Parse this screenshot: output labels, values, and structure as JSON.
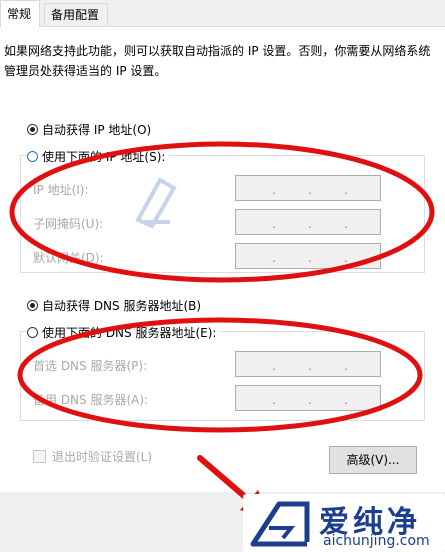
{
  "tabs": [
    {
      "label": "常规",
      "active": true
    },
    {
      "label": "备用配置",
      "active": false
    }
  ],
  "description": "如果网络支持此功能，则可以获取自动指派的 IP 设置。否则，你需要从网络系统管理员处获得适当的 IP 设置。",
  "ip_section": {
    "auto_label": "自动获得 IP 地址(O)",
    "auto_selected": true,
    "manual_label": "使用下面的 IP 地址(S):",
    "fields": [
      {
        "label": "IP 地址(I):"
      },
      {
        "label": "子网掩码(U):"
      },
      {
        "label": "默认网关(D):"
      }
    ]
  },
  "dns_section": {
    "auto_label": "自动获得 DNS 服务器地址(B)",
    "auto_selected": true,
    "manual_label": "使用下面的 DNS 服务器地址(E):",
    "fields": [
      {
        "label": "首选 DNS 服务器(P):"
      },
      {
        "label": "备用 DNS 服务器(A):"
      }
    ]
  },
  "validate_checkbox": {
    "label": "退出时验证设置(L)",
    "checked": false
  },
  "advanced_button": "高级(V)...",
  "watermark": {
    "cn": "爱纯净",
    "en": "aichunjing.com"
  },
  "colors": {
    "annotation": "#e01010",
    "accent": "#1e6fd9",
    "brand": "#1c3e8c"
  }
}
